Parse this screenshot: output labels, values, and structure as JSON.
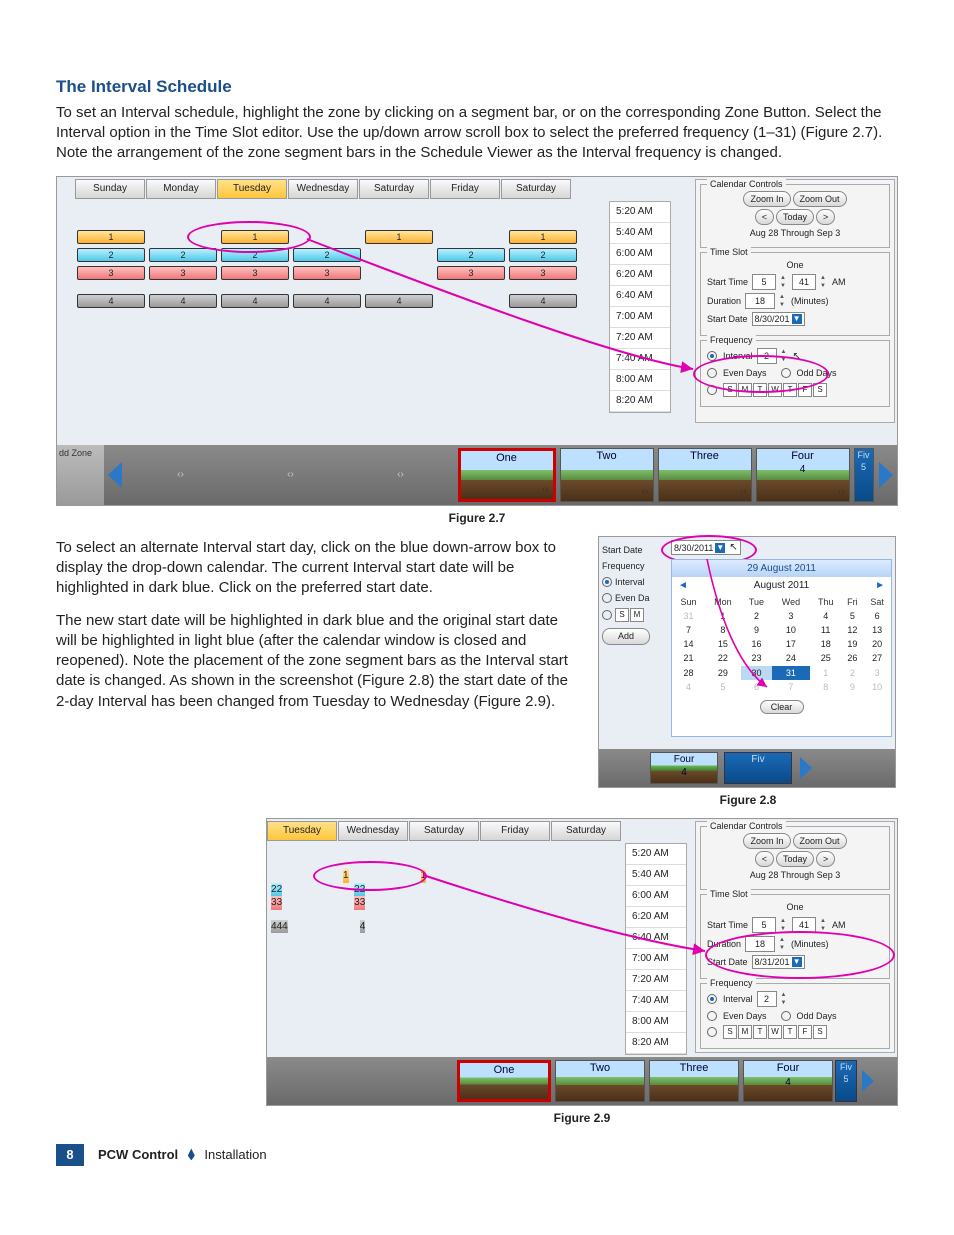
{
  "heading": "The Interval Schedule",
  "para1": "To set an Interval schedule, highlight the zone by clicking on a segment bar, or on the corresponding Zone Button. Select the Interval option in the Time Slot editor. Use the up/down arrow scroll box to select the preferred frequency (1–31) (Figure 2.7). Note the arrangement of the zone segment bars in the Schedule Viewer as the Interval frequency is changed.",
  "para2": "To select an alternate Interval start day, click on the blue down-arrow box to display the drop-down calendar. The current Interval start date will be highlighted in dark blue. Click on the preferred start date.",
  "para3": "The new start date will be highlighted in dark blue and the original start date will be highlighted in light blue (after the calendar window is closed and reopened). Note the placement of the zone segment bars as the Interval start date is changed. As shown in the screenshot (Figure 2.8) the start date of the 2-day Interval has been changed from Tuesday to Wednesday (Figure 2.9).",
  "captions": {
    "f27": "Figure 2.7",
    "f28": "Figure 2.8",
    "f29": "Figure 2.9"
  },
  "days": [
    "Sunday",
    "Monday",
    "Tuesday",
    "Wednesday",
    "Saturday",
    "Friday",
    "Saturday"
  ],
  "days29": [
    "Tuesday",
    "Wednesday",
    "Saturday",
    "Friday",
    "Saturday"
  ],
  "times": [
    "5:20 AM",
    "5:40 AM",
    "6:00 AM",
    "6:20 AM",
    "6:40 AM",
    "7:00 AM",
    "7:20 AM",
    "7:40 AM",
    "8:00 AM",
    "8:20 AM"
  ],
  "zones": [
    "One",
    "Two",
    "Three",
    "Four"
  ],
  "zone_extra_num": "4",
  "zone_fiv_label": "Fiv",
  "zone_fiv_num": "5",
  "addzone_label": "dd Zone",
  "calendar_controls": {
    "legend": "Calendar Controls",
    "zoom_in": "Zoom In",
    "zoom_out": "Zoom Out",
    "today": "Today",
    "range": "Aug 28 Through Sep 3",
    "prev": "<",
    "next": ">"
  },
  "timeslot": {
    "legend": "Time Slot",
    "zone_name": "One",
    "start_time_label": "Start Time",
    "start_h": "5",
    "start_m": "41",
    "ampm": "AM",
    "duration_label": "Duration",
    "duration_val": "18",
    "duration_unit": "(Minutes)",
    "start_date_label": "Start Date",
    "start_date_val_27": "8/30/201",
    "start_date_val_29": "8/31/201"
  },
  "frequency": {
    "legend": "Frequency",
    "interval_label": "Interval",
    "interval_val": "2",
    "even_label": "Even Days",
    "odd_label": "Odd Days",
    "day_letters": [
      "S",
      "M",
      "T",
      "W",
      "T",
      "F",
      "S"
    ]
  },
  "fig28": {
    "start_date_label": "Start Date",
    "start_date_val": "8/30/2011",
    "frequency_label": "Frequency",
    "interval_label": "Interval",
    "even_label": "Even Da",
    "sm_letters": [
      "S",
      "M"
    ],
    "add_label": "Add",
    "titlebar": "29 August 2011",
    "month": "August 2011",
    "prev": "◄",
    "next": "►",
    "weekdays": [
      "Sun",
      "Mon",
      "Tue",
      "Wed",
      "Thu",
      "Fri",
      "Sat"
    ],
    "grid": [
      [
        {
          "v": "31",
          "dim": true
        },
        {
          "v": "1"
        },
        {
          "v": "2"
        },
        {
          "v": "3"
        },
        {
          "v": "4"
        },
        {
          "v": "5"
        },
        {
          "v": "6"
        }
      ],
      [
        {
          "v": "7"
        },
        {
          "v": "8"
        },
        {
          "v": "9"
        },
        {
          "v": "10"
        },
        {
          "v": "11"
        },
        {
          "v": "12"
        },
        {
          "v": "13"
        }
      ],
      [
        {
          "v": "14"
        },
        {
          "v": "15"
        },
        {
          "v": "16"
        },
        {
          "v": "17"
        },
        {
          "v": "18"
        },
        {
          "v": "19"
        },
        {
          "v": "20"
        }
      ],
      [
        {
          "v": "21"
        },
        {
          "v": "22"
        },
        {
          "v": "23"
        },
        {
          "v": "24"
        },
        {
          "v": "25"
        },
        {
          "v": "26"
        },
        {
          "v": "27"
        }
      ],
      [
        {
          "v": "28"
        },
        {
          "v": "29"
        },
        {
          "v": "30",
          "lt": true
        },
        {
          "v": "31",
          "dk": true
        },
        {
          "v": "1",
          "dim": true
        },
        {
          "v": "2",
          "dim": true
        },
        {
          "v": "3",
          "dim": true
        }
      ],
      [
        {
          "v": "4",
          "dim": true
        },
        {
          "v": "5",
          "dim": true
        },
        {
          "v": "6",
          "dim": true
        },
        {
          "v": "7",
          "dim": true
        },
        {
          "v": "8",
          "dim": true
        },
        {
          "v": "9",
          "dim": true
        },
        {
          "v": "10",
          "dim": true
        }
      ]
    ],
    "clear": "Clear",
    "strip_cards": [
      "Four"
    ],
    "strip_four_num": "4",
    "strip_fiv": "Fiv"
  },
  "footer": {
    "page": "8",
    "prod": "PCW Control",
    "section": "Installation"
  }
}
